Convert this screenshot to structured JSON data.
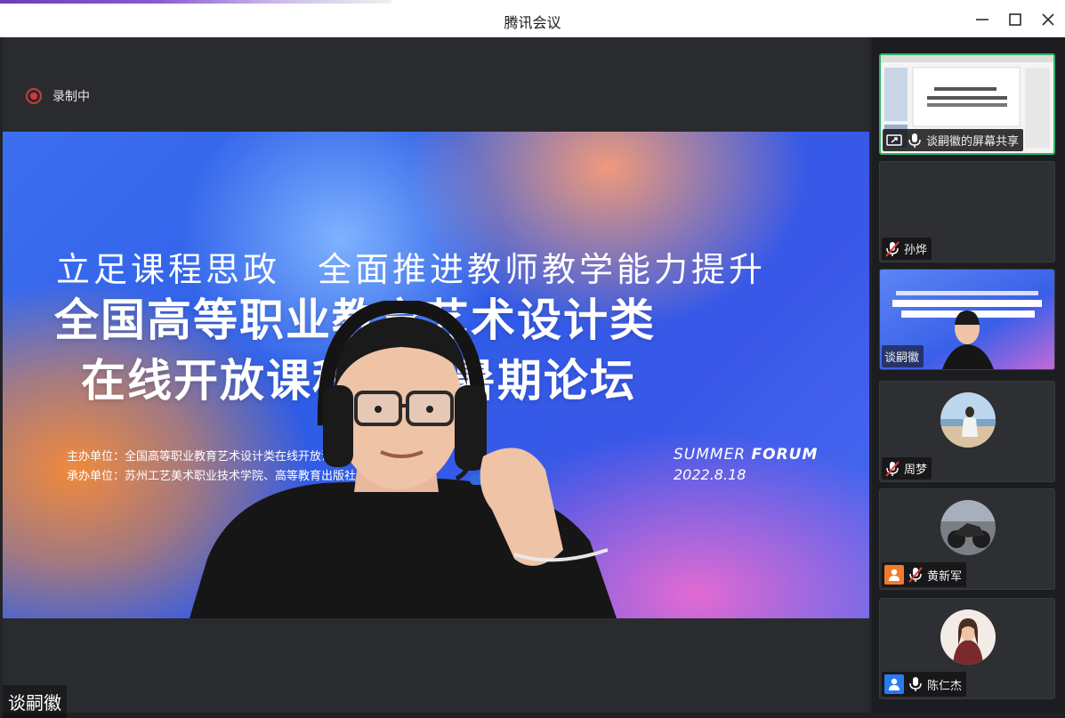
{
  "window": {
    "title": "腾讯会议"
  },
  "recording": {
    "label": "录制中"
  },
  "slide": {
    "line1": "立足课程思政　全面推进教师教学能力提升",
    "line2": "全国高等职业教育艺术设计类",
    "line3": "在线开放课程联盟暑期论坛",
    "host": "主办单位：全国高等职业教育艺术设计类在线开放课程联盟",
    "organizer": "承办单位：苏州工艺美术职业技术学院、高等教育出版社",
    "forum_a": "SUMMER",
    "forum_b": "FORUM",
    "date": "2022.8.18"
  },
  "speaker": {
    "name": "谈嗣徽"
  },
  "participants": [
    {
      "name": "谈嗣徽的屏幕共享",
      "type": "screen-share",
      "mic": "on",
      "active": true
    },
    {
      "name": "孙烨",
      "type": "video-off",
      "mic": "muted"
    },
    {
      "name": "谈嗣徽",
      "type": "video",
      "mic": "on"
    },
    {
      "name": "周梦",
      "type": "avatar",
      "mic": "muted"
    },
    {
      "name": "黄新军",
      "type": "avatar",
      "mic": "muted",
      "badge_color": "#f07b2a"
    },
    {
      "name": "陈仁杰",
      "type": "avatar",
      "mic": "on",
      "badge_color": "#2a7bf0"
    }
  ],
  "colors": {
    "accent_green": "#2fb56a",
    "record_red": "#d33a3a",
    "slide_blue": "#3d6ff0"
  }
}
